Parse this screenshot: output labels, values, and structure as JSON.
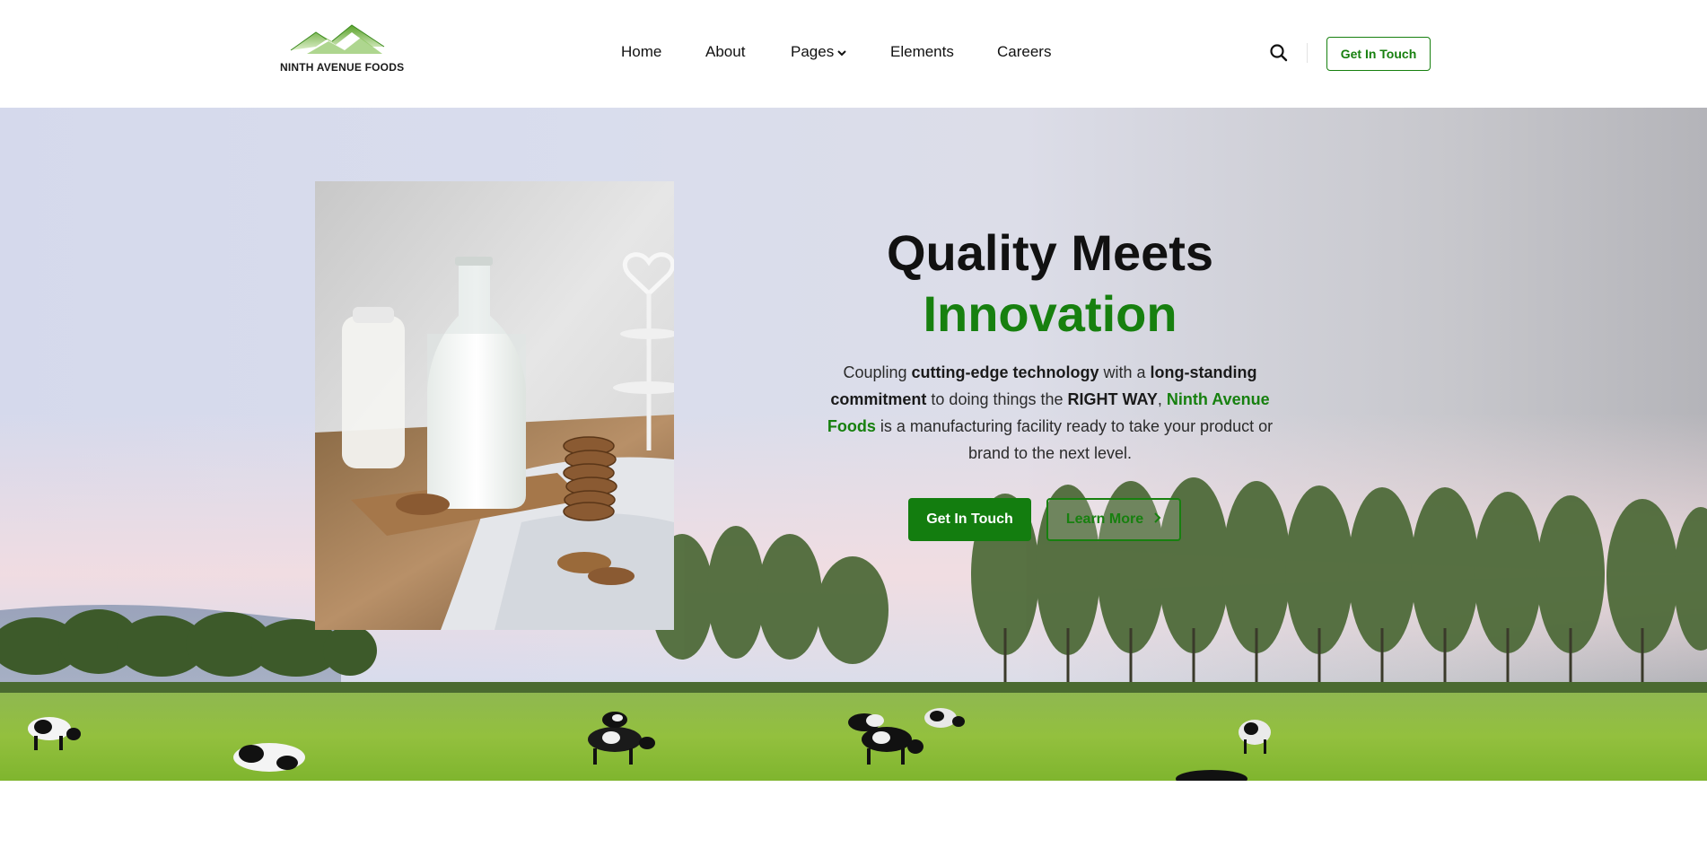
{
  "brand": {
    "name": "NINTH AVENUE FOODS",
    "accent": "#17800f"
  },
  "nav": {
    "items": [
      {
        "label": "Home"
      },
      {
        "label": "About"
      },
      {
        "label": "Pages",
        "has_dropdown": true
      },
      {
        "label": "Elements"
      },
      {
        "label": "Careers"
      }
    ],
    "search_icon": "search-icon",
    "cta_label": "Get In Touch"
  },
  "hero": {
    "title_line1": "Quality Meets",
    "title_line2": "Innovation",
    "desc": {
      "p1": "Coupling ",
      "b1": "cutting-edge technology",
      "p2": " with a ",
      "b2": "long-standing commitment",
      "p3": " to doing things the ",
      "b3": "RIGHT WAY",
      "p4": ", ",
      "brand": "Ninth Avenue Foods",
      "p5": " is a manufacturing facility ready to take your product or brand to the next level."
    },
    "primary_button": "Get In Touch",
    "secondary_button": "Learn More"
  }
}
